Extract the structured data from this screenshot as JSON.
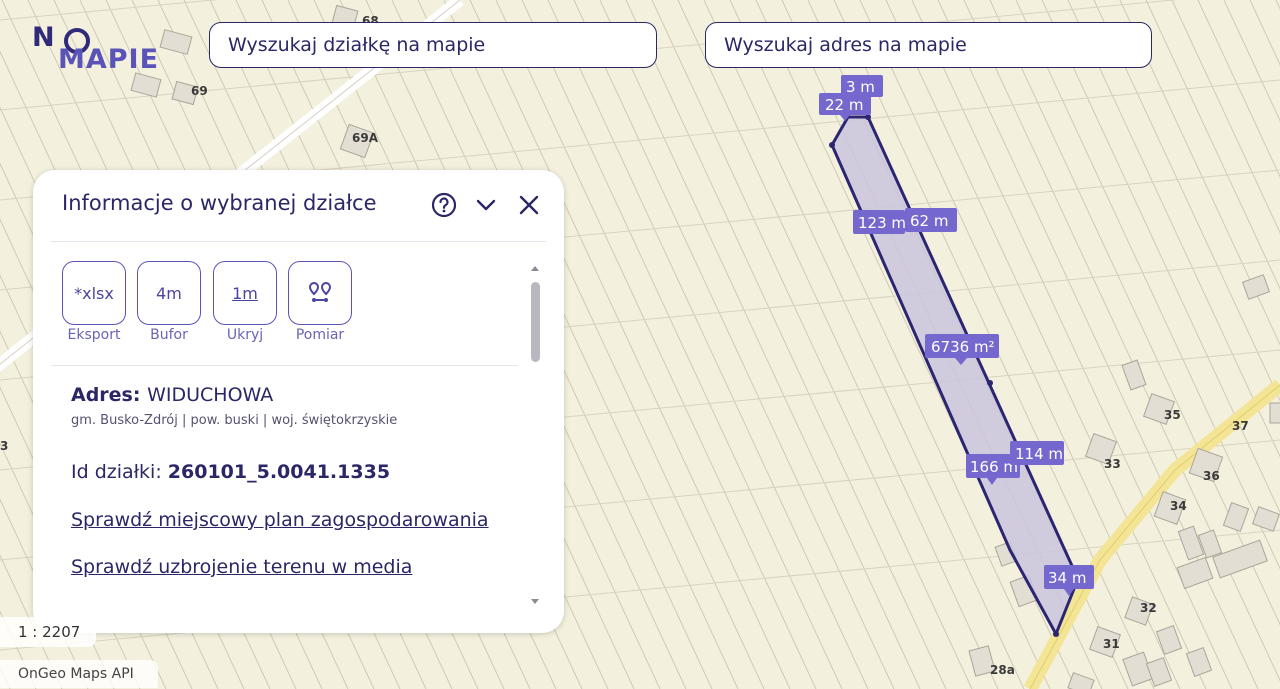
{
  "logo": {
    "part1": "N",
    "part2": "MAPIE"
  },
  "search": {
    "parcel_placeholder": "Wyszukaj działkę na mapie",
    "address_placeholder": "Wyszukaj adres na mapie"
  },
  "panel": {
    "title": "Informacje o wybranej działce",
    "icons": [
      "help-icon",
      "chevron-down-icon",
      "close-icon"
    ],
    "tools": [
      {
        "icon_text": "*xlsx",
        "label": "Eksport"
      },
      {
        "icon_text": "4m",
        "label": "Bufor"
      },
      {
        "icon_text": "1m",
        "label": "Ukryj"
      },
      {
        "icon_text": "",
        "label": "Pomiar"
      }
    ],
    "address_label": "Adres:",
    "address_value": "WIDUCHOWA",
    "admin_line": "gm. Busko-Zdrój | pow. buski | woj. świętokrzyskie",
    "id_label": "Id działki:",
    "id_value": "260101_5.0041.1335",
    "link_plan": "Sprawdź miejscowy plan zagospodarowania",
    "link_media": "Sprawdź uzbrojenie terenu w media"
  },
  "map": {
    "accent_color": "#2b2572",
    "parcel_fill": "#c9c6de",
    "label_bg": "#7468cf",
    "measurements": [
      "3 m",
      "22 m",
      "123 m",
      "62 m",
      "6736 m²",
      "166 m",
      "114 m",
      "34 m"
    ],
    "house_numbers": [
      "68",
      "69",
      "69A",
      "35",
      "37",
      "33",
      "36",
      "34",
      "32",
      "31",
      "28a",
      "3"
    ],
    "scale_text": "1 : 2207",
    "attribution": "OnGeo Maps API"
  }
}
